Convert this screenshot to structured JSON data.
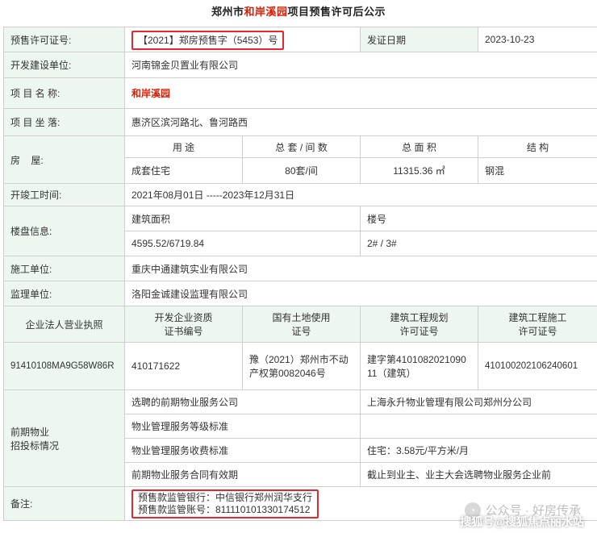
{
  "title": {
    "prefix": "郑州市",
    "project": "和岸溪园",
    "suffix": "项目预售许可后公示"
  },
  "rows": {
    "permit": {
      "label": "预售许可证号:",
      "value": "【2021】郑房预售字（5453）号",
      "date_label": "发证日期",
      "date_value": "2023-10-23"
    },
    "developer": {
      "label": "开发建设单位:",
      "value": "河南锦金贝置业有限公司"
    },
    "project_name": {
      "label": "项 目 名 称:",
      "value": "和岸溪园"
    },
    "location": {
      "label": "项 目 坐 落:",
      "value": "惠济区滨河路北、鲁河路西"
    },
    "housing": {
      "label": "房    屋:",
      "headers": [
        "用 途",
        "总 套 / 间 数",
        "总 面 积",
        "结 构"
      ],
      "values": [
        "成套住宅",
        "80套/间",
        "11315.36 ㎡",
        "钢混"
      ]
    },
    "construction_time": {
      "label": "开竣工时间:",
      "value": "2021年08月01日 -----2023年12月31日"
    },
    "building_info": {
      "label": "楼盘信息:",
      "area_label": "建筑面积",
      "area_value": "4595.52/6719.84",
      "bldg_label": "楼号",
      "bldg_value": "2# / 3#"
    },
    "contractor": {
      "label": "施工单位:",
      "value": "重庆中通建筑实业有限公司"
    },
    "supervisor": {
      "label": "监理单位:",
      "value": "洛阳金诚建设监理有限公司"
    },
    "licenses": {
      "headers": [
        "企业法人营业执照",
        "开发企业资质\n证书编号",
        "国有土地使用\n证号",
        "建筑工程规划\n许可证号",
        "建筑工程施工\n许可证号"
      ],
      "values": [
        "91410108MA9G58W86R",
        "410171622",
        "豫（2021）郑州市不动产权第0082046号",
        "建字第410108202109011（建筑）",
        "410100202106240601"
      ]
    },
    "property_mgmt": {
      "label": "前期物业\n招投标情况",
      "rows": [
        {
          "k": "选聘的前期物业服务公司",
          "v": "上海永升物业管理有限公司郑州分公司"
        },
        {
          "k": "物业管理服务等级标准",
          "v": ""
        },
        {
          "k": "物业管理服务收费标准",
          "v": "住宅：3.58元/平方米/月"
        },
        {
          "k": "前期物业服务合同有效期",
          "v": "截止到业主、业主大会选聘物业服务企业前"
        }
      ]
    },
    "remark": {
      "label": "备注:",
      "bank": "预售款监管银行：中信银行郑州润华支行",
      "account": "预售款监管账号：811110101330174512"
    }
  },
  "watermark": {
    "text": "公众号 · 好房传承",
    "sohu": "搜狐号@搜狐焦点丽水站"
  }
}
